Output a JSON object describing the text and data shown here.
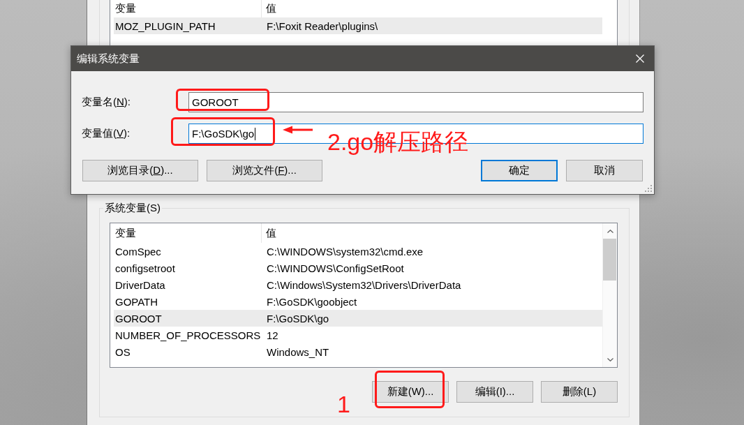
{
  "background_window": {
    "user_variables": {
      "columns": [
        "变量",
        "值"
      ],
      "rows": [
        {
          "name": "MOZ_PLUGIN_PATH",
          "value": "F:\\Foxit Reader\\plugins\\",
          "selected": true
        }
      ]
    },
    "system_variables": {
      "title": "系统变量(S)",
      "columns": [
        "变量",
        "值"
      ],
      "rows": [
        {
          "name": "ComSpec",
          "value": "C:\\WINDOWS\\system32\\cmd.exe",
          "selected": false
        },
        {
          "name": "configsetroot",
          "value": "C:\\WINDOWS\\ConfigSetRoot",
          "selected": false
        },
        {
          "name": "DriverData",
          "value": "C:\\Windows\\System32\\Drivers\\DriverData",
          "selected": false
        },
        {
          "name": "GOPATH",
          "value": "F:\\GoSDK\\goobject",
          "selected": false
        },
        {
          "name": "GOROOT",
          "value": "F:\\GoSDK\\go",
          "selected": true
        },
        {
          "name": "NUMBER_OF_PROCESSORS",
          "value": "12",
          "selected": false
        },
        {
          "name": "OS",
          "value": "Windows_NT",
          "selected": false
        }
      ],
      "buttons": [
        {
          "label": "新建(W)..."
        },
        {
          "label": "编辑(I)..."
        },
        {
          "label": "删除(L)"
        }
      ]
    }
  },
  "dialog": {
    "title": "编辑系统变量",
    "fields": [
      {
        "label": {
          "before": "变量名(",
          "access_key": "N",
          "after": "):"
        },
        "value": "GOROOT",
        "focused": false
      },
      {
        "label": {
          "before": "变量值(",
          "access_key": "V",
          "after": "):"
        },
        "value": "F:\\GoSDK\\go",
        "focused": true
      }
    ],
    "left_buttons": [
      {
        "before": "浏览目录(",
        "access_key": "D",
        "after": ")...",
        "default": false
      },
      {
        "before": "浏览文件(",
        "access_key": "F",
        "after": ")...",
        "default": false
      }
    ],
    "right_buttons": [
      {
        "label": "确定",
        "default": true
      },
      {
        "label": "取消",
        "default": false
      }
    ]
  },
  "annotations": {
    "value_note": "2.go解压路径",
    "step_note": "1"
  }
}
